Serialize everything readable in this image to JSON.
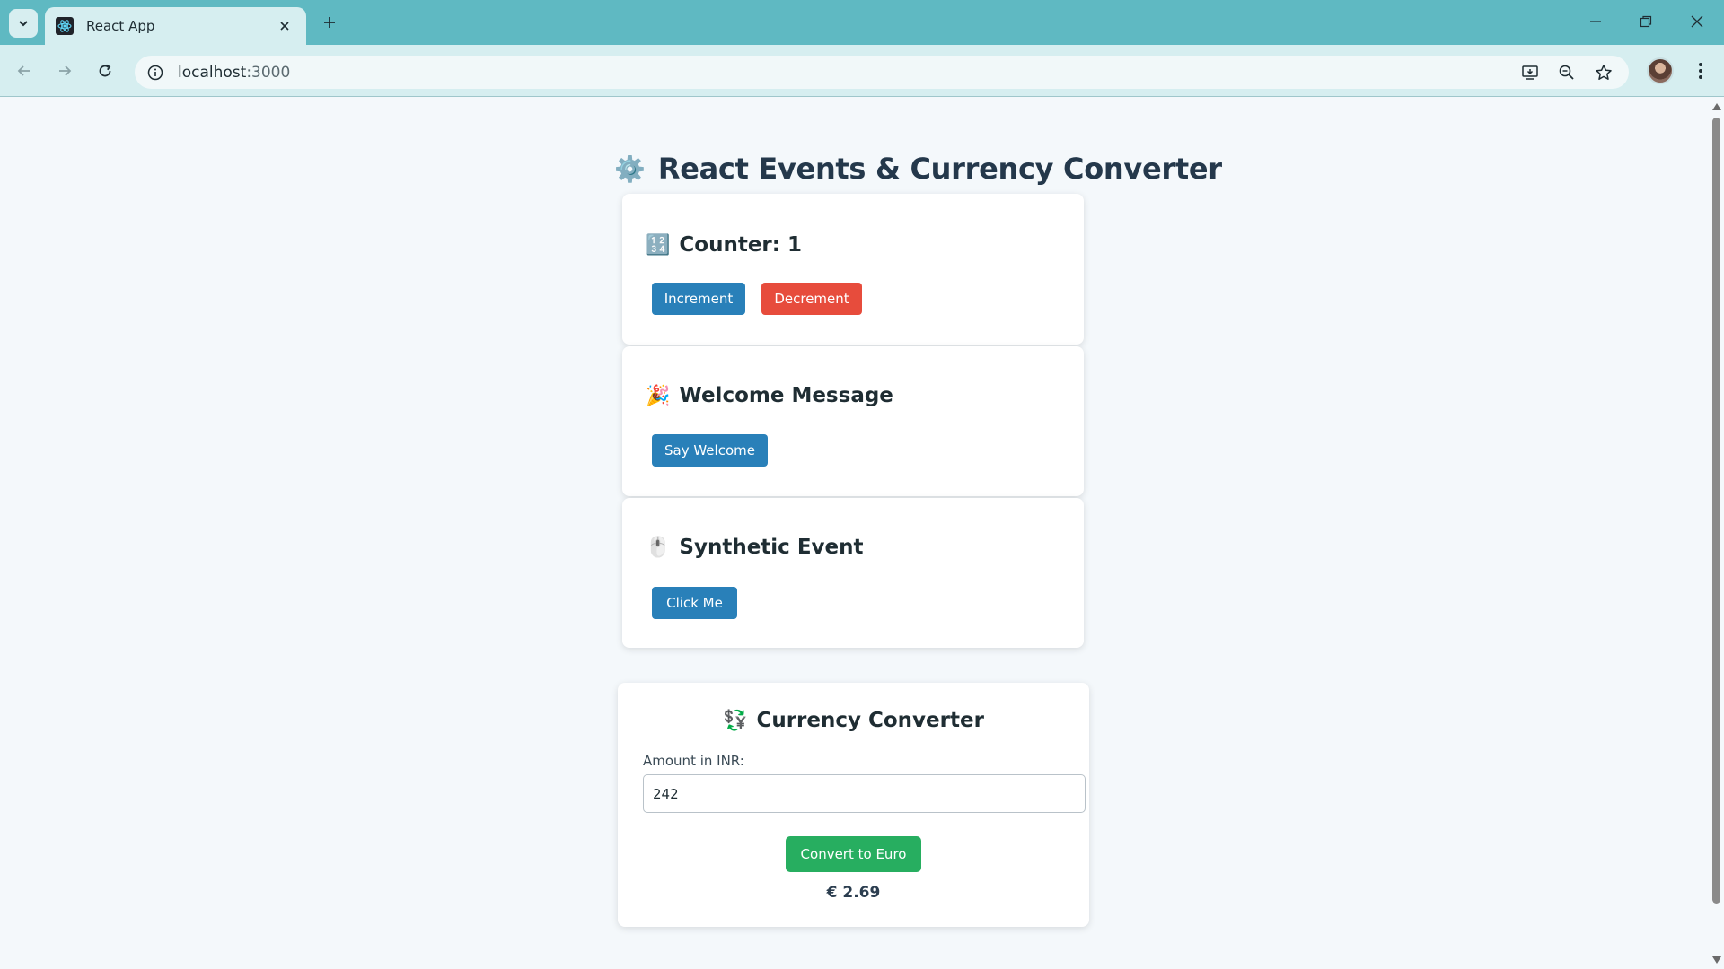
{
  "browser": {
    "tab_title": "React App",
    "url_host": "localhost",
    "url_port": ":3000"
  },
  "page": {
    "title": "React Events & Currency Converter",
    "title_emoji": "⚙️"
  },
  "counter": {
    "emoji": "🔢",
    "heading": "Counter: 1",
    "increment_label": "Increment",
    "decrement_label": "Decrement"
  },
  "welcome": {
    "emoji": "🎉",
    "heading": "Welcome Message",
    "button_label": "Say Welcome"
  },
  "synthetic": {
    "emoji": "🖱️",
    "heading": "Synthetic Event",
    "button_label": "Click Me"
  },
  "converter": {
    "emoji": "💱",
    "heading": "Currency Converter",
    "amount_label": "Amount in INR:",
    "amount_value": "242",
    "button_label": "Convert to Euro",
    "result": "€ 2.69"
  },
  "colors": {
    "primary": "#2980b9",
    "danger": "#e74c3c",
    "success": "#27ae60",
    "heading": "#24384b"
  }
}
